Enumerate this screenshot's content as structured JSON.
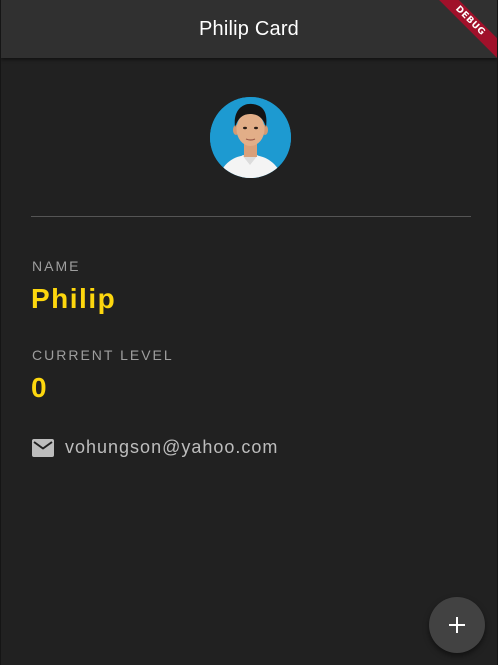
{
  "appbar": {
    "title": "Philip Card"
  },
  "debug_banner": {
    "label": "DEBUG",
    "color": "#a0102a"
  },
  "profile": {
    "avatar_icon": "profile-photo"
  },
  "name": {
    "label": "NAME",
    "value": "Philip"
  },
  "level": {
    "label": "CURRENT LEVEL",
    "value": "0"
  },
  "contact": {
    "icon": "mail-icon",
    "email": "vohungson@yahoo.com"
  },
  "fab": {
    "icon": "plus-icon"
  },
  "colors": {
    "background": "#212121",
    "appbar": "#303030",
    "accent_value": "#fdd70e",
    "label": "#9e9e9e",
    "fab": "#424242"
  }
}
